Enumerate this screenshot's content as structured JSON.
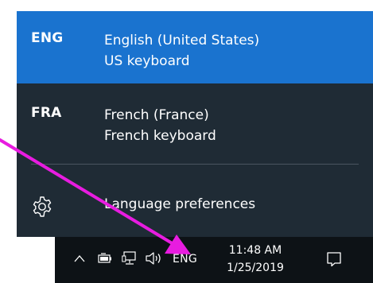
{
  "language_flyout": {
    "languages": [
      {
        "code": "ENG",
        "name": "English (United States)",
        "keyboard": "US keyboard",
        "selected": true
      },
      {
        "code": "FRA",
        "name": "French (France)",
        "keyboard": "French keyboard",
        "selected": false
      }
    ],
    "preferences_label": "Language preferences"
  },
  "taskbar": {
    "language_indicator": "ENG",
    "time": "11:48 AM",
    "date": "1/25/2019"
  },
  "colors": {
    "flyout_bg": "#1f2b35",
    "selected_bg": "#1a73cf",
    "taskbar_bg": "#0d1216",
    "annotation_arrow": "#e81ce0"
  },
  "icons": [
    "gear-icon",
    "chevron-up-icon",
    "battery-icon",
    "network-icon",
    "volume-icon",
    "notification-icon"
  ]
}
